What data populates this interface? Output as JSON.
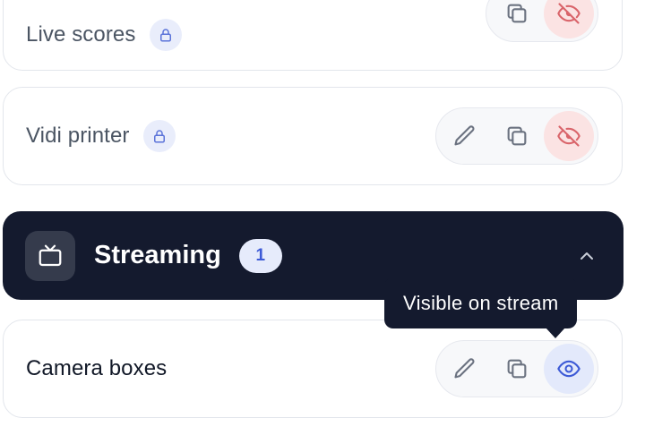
{
  "items": [
    {
      "label": "Live scores",
      "locked": true,
      "visibility": "hidden",
      "actions": [
        "duplicate",
        "visibility"
      ]
    },
    {
      "label": "Vidi printer",
      "locked": true,
      "visibility": "hidden",
      "actions": [
        "edit",
        "duplicate",
        "visibility"
      ]
    }
  ],
  "section": {
    "title": "Streaming",
    "count": "1",
    "expanded": true,
    "icon": "tv-icon"
  },
  "section_items": [
    {
      "label": "Camera boxes",
      "locked": false,
      "visibility": "visible",
      "actions": [
        "edit",
        "duplicate",
        "visibility"
      ]
    }
  ],
  "tooltip": {
    "text": "Visible on stream"
  },
  "colors": {
    "danger_bg": "#fbe3e3",
    "danger_icon": "#d9646a",
    "active_bg": "#e3e9fb",
    "active_icon": "#3d5ad6",
    "section_bg": "#141a2e"
  }
}
